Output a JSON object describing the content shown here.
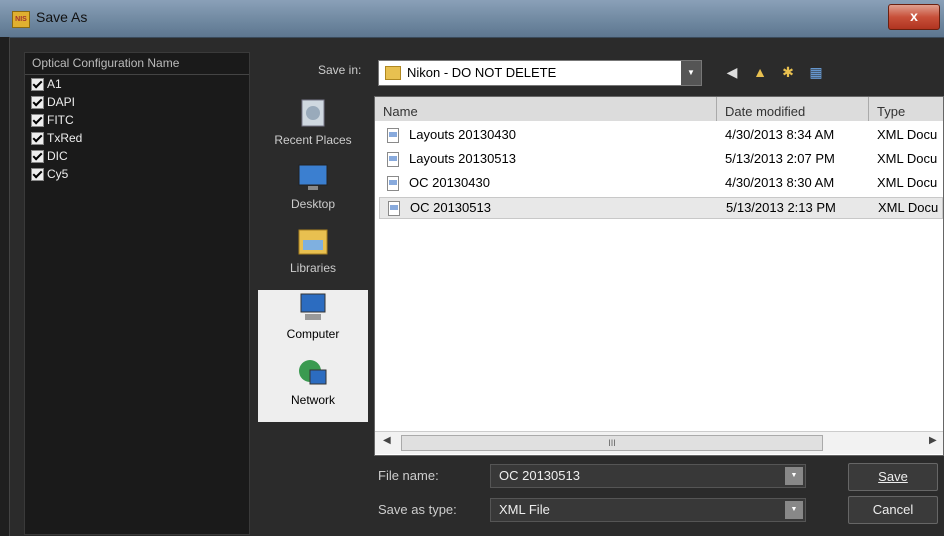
{
  "window": {
    "title": "Save As",
    "app_icon_text": "NIS",
    "close_glyph": "x"
  },
  "config_panel": {
    "header": "Optical Configuration Name",
    "items": [
      {
        "label": "A1",
        "checked": true
      },
      {
        "label": "DAPI",
        "checked": true
      },
      {
        "label": "FITC",
        "checked": true
      },
      {
        "label": "TxRed",
        "checked": true
      },
      {
        "label": "DIC",
        "checked": true
      },
      {
        "label": "Cy5",
        "checked": true
      }
    ]
  },
  "save_in": {
    "label": "Save in:",
    "value": "Nikon - DO NOT DELETE"
  },
  "toolbar_icons": [
    "back-icon",
    "up-folder-icon",
    "new-folder-icon",
    "view-menu-icon"
  ],
  "places": [
    {
      "label": "Recent Places",
      "icon": "recent-places-icon",
      "selected": false
    },
    {
      "label": "Desktop",
      "icon": "desktop-icon",
      "selected": false
    },
    {
      "label": "Libraries",
      "icon": "libraries-icon",
      "selected": false
    },
    {
      "label": "Computer",
      "icon": "computer-icon",
      "selected": true
    },
    {
      "label": "Network",
      "icon": "network-icon",
      "selected": true
    }
  ],
  "file_list": {
    "columns": [
      "Name",
      "Date modified",
      "Type"
    ],
    "rows": [
      {
        "name": "Layouts 20130430",
        "date": "4/30/2013 8:34 AM",
        "type": "XML Docu",
        "selected": false
      },
      {
        "name": "Layouts 20130513",
        "date": "5/13/2013 2:07 PM",
        "type": "XML Docu",
        "selected": false
      },
      {
        "name": "OC 20130430",
        "date": "4/30/2013 8:30 AM",
        "type": "XML Docu",
        "selected": false
      },
      {
        "name": "OC 20130513",
        "date": "5/13/2013 2:13 PM",
        "type": "XML Docu",
        "selected": true
      }
    ],
    "scroll_thumb_grip": "III"
  },
  "file_name": {
    "label": "File name:",
    "value": "OC 20130513"
  },
  "save_as_type": {
    "label": "Save as type:",
    "value": "XML File"
  },
  "buttons": {
    "save": "Save",
    "cancel": "Cancel"
  },
  "colors": {
    "title_bar": "#6e879f",
    "close_button": "#c8503a",
    "dialog_bg": "#2b2b2b",
    "selected_row": "#e8e8e8"
  }
}
